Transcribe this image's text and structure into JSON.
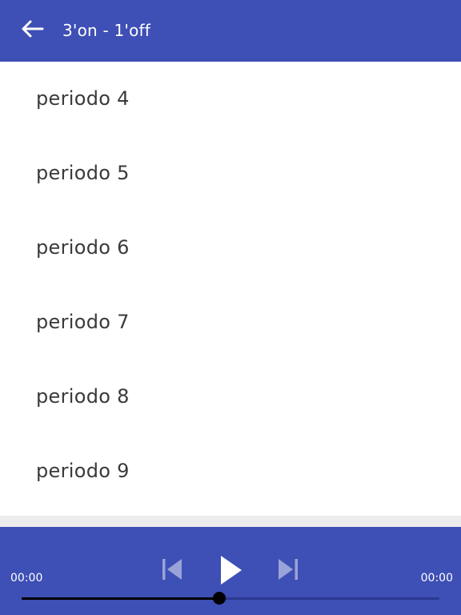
{
  "app_bar": {
    "title": "3'on - 1'off",
    "back_icon": "arrow-left-icon",
    "background": "#3e4fb5"
  },
  "list": {
    "items": [
      {
        "label": "periodo 4"
      },
      {
        "label": "periodo 5"
      },
      {
        "label": "periodo 6"
      },
      {
        "label": "periodo 7"
      },
      {
        "label": "periodo 8"
      },
      {
        "label": "periodo 9"
      }
    ]
  },
  "player": {
    "time_start": "00:00",
    "time_end": "00:00",
    "prev_icon": "skip-previous-icon",
    "play_icon": "play-icon",
    "next_icon": "skip-next-icon",
    "progress_fraction": 0.473,
    "accent": "#3e4fb5"
  }
}
